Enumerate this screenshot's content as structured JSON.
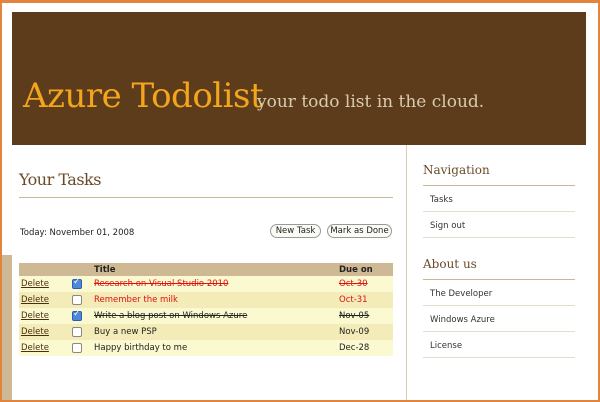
{
  "header": {
    "title": "Azure Todolist",
    "tagline": "your todo list in the cloud."
  },
  "main": {
    "heading": "Your Tasks",
    "today": "Today: November 01, 2008",
    "buttons": {
      "new_task": "New Task",
      "mark_done": "Mark as Done"
    },
    "table": {
      "columns": [
        "",
        "",
        "Title",
        "Due on"
      ],
      "delete_label": "Delete",
      "rows": [
        {
          "checked": true,
          "title": "Research on Visual Studio 2010",
          "due": "Oct-30",
          "style": "overdue-done"
        },
        {
          "checked": false,
          "title": "Remember the milk",
          "due": "Oct-31",
          "style": "overdue"
        },
        {
          "checked": true,
          "title": "Write a blog post on Windows Azure",
          "due": "Nov-05",
          "style": "done"
        },
        {
          "checked": false,
          "title": "Buy a new PSP",
          "due": "Nov-09",
          "style": "normal"
        },
        {
          "checked": false,
          "title": "Happy birthday to me",
          "due": "Dec-28",
          "style": "normal"
        }
      ]
    }
  },
  "sidebar": {
    "sections": [
      {
        "heading": "Navigation",
        "items": [
          "Tasks",
          "Sign out"
        ]
      },
      {
        "heading": "About us",
        "items": [
          "The Developer",
          "Windows Azure",
          "License"
        ]
      }
    ]
  },
  "colors": {
    "header_bg": "#5c3c1b",
    "title": "#f3a51b",
    "frame": "#e3843d",
    "overdue": "#e01010",
    "table_header": "#cfb995"
  }
}
